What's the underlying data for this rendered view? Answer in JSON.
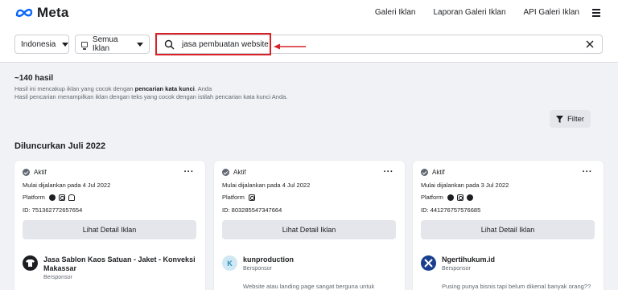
{
  "header": {
    "brand": "Meta",
    "nav": [
      "Galeri Iklan",
      "Laporan Galeri Iklan",
      "API Galeri Iklan"
    ]
  },
  "search": {
    "country": "Indonesia",
    "ad_type": "Semua Iklan",
    "query": "jasa pembuatan website"
  },
  "results": {
    "count": "~140 hasil",
    "line1_prefix": "Hasil ini mencakup iklan yang cocok dengan ",
    "line1_bold": "pencarian kata kunci",
    "line1_suffix": ". Anda",
    "line2": "Hasil pencarian menampilkan iklan dengan teks yang cocok dengan istilah pencarian kata kunci Anda."
  },
  "filter_label": "Filter",
  "section_title": "Diluncurkan Juli 2022",
  "cards": [
    {
      "status": "Aktif",
      "started": "Mulai dijalankan pada 4 Jul 2022",
      "platform_label": "Platform",
      "platforms": [
        "facebook",
        "instagram",
        "audience-network"
      ],
      "id": "ID: 751362772657654",
      "button": "Lihat Detail Iklan",
      "advertiser": "Jasa Sablon Kaos Satuan - Jaket - Konveksi Makassar",
      "sponsored": "Bersponsor",
      "avatar_letter": "",
      "body": ""
    },
    {
      "status": "Aktif",
      "started": "Mulai dijalankan pada 4 Jul 2022",
      "platform_label": "Platform",
      "platforms": [
        "instagram"
      ],
      "id": "ID: 803285547347664",
      "button": "Lihat Detail Iklan",
      "advertiser": "kunproduction",
      "sponsored": "Bersponsor",
      "avatar_letter": "K",
      "body": "Website atau landing page sangat berguna untuk"
    },
    {
      "status": "Aktif",
      "started": "Mulai dijalankan pada 3 Jul 2022",
      "platform_label": "Platform",
      "platforms": [
        "facebook",
        "instagram",
        "messenger"
      ],
      "id": "ID: 441276757576685",
      "button": "Lihat Detail Iklan",
      "advertiser": "Ngertihukum.id",
      "sponsored": "Bersponsor",
      "avatar_letter": "",
      "body": "Pusing punya bisnis tapi belum dikenal banyak orang??"
    }
  ],
  "colors": {
    "accent_red": "#d92128",
    "button_gray": "#e4e6eb",
    "background": "#f0f2f5"
  }
}
